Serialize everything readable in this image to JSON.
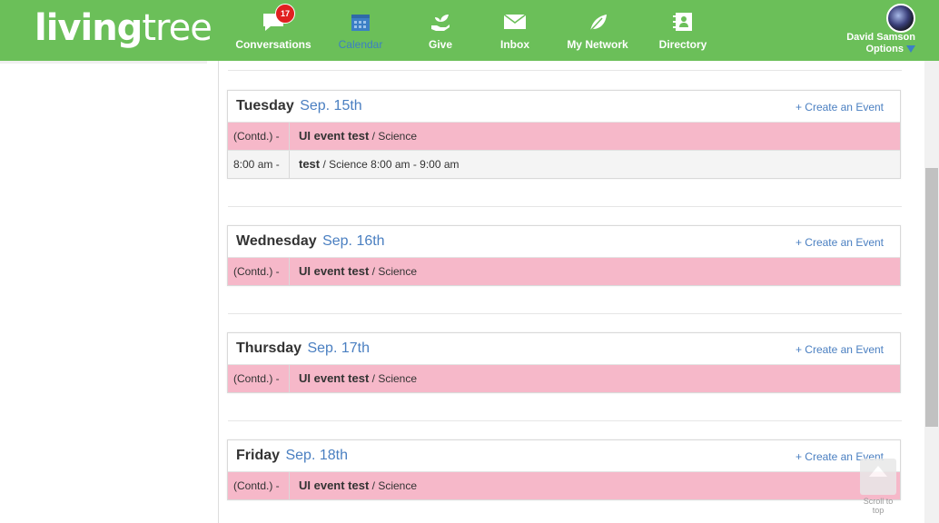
{
  "brand": {
    "logo_bold": "living",
    "logo_light": "tree"
  },
  "nav": {
    "items": [
      {
        "label": "Conversations",
        "icon": "chat-bubble-icon",
        "badge": "17"
      },
      {
        "label": "Calendar",
        "icon": "calendar-icon",
        "active": true
      },
      {
        "label": "Give",
        "icon": "hand-plant-icon"
      },
      {
        "label": "Inbox",
        "icon": "envelope-icon"
      },
      {
        "label": "My Network",
        "icon": "leaf-icon"
      },
      {
        "label": "Directory",
        "icon": "contacts-book-icon"
      }
    ]
  },
  "user": {
    "name": "David Samson",
    "options": "Options"
  },
  "calendar": {
    "create_label": "+ Create an Event",
    "days": [
      {
        "weekday": "Tuesday",
        "date": "Sep. 15th",
        "events": [
          {
            "time": "(Contd.) -",
            "title": "UI event test",
            "meta": " / Science",
            "style": "pink"
          },
          {
            "time": "8:00 am -",
            "title": "test",
            "meta": " / Science 8:00 am - 9:00 am",
            "style": "grey"
          }
        ]
      },
      {
        "weekday": "Wednesday",
        "date": "Sep. 16th",
        "events": [
          {
            "time": "(Contd.) -",
            "title": "UI event test",
            "meta": " / Science",
            "style": "pink"
          }
        ]
      },
      {
        "weekday": "Thursday",
        "date": "Sep. 17th",
        "events": [
          {
            "time": "(Contd.) -",
            "title": "UI event test",
            "meta": " / Science",
            "style": "pink"
          }
        ]
      },
      {
        "weekday": "Friday",
        "date": "Sep. 18th",
        "events": [
          {
            "time": "(Contd.) -",
            "title": "UI event test",
            "meta": " / Science",
            "style": "pink"
          }
        ]
      }
    ]
  },
  "scroll_top": {
    "label": "Scroll to top"
  },
  "colors": {
    "header": "#6bbf59",
    "accent": "#4a7fc1",
    "event_pink": "#f6b8c9",
    "badge": "#e02020"
  }
}
